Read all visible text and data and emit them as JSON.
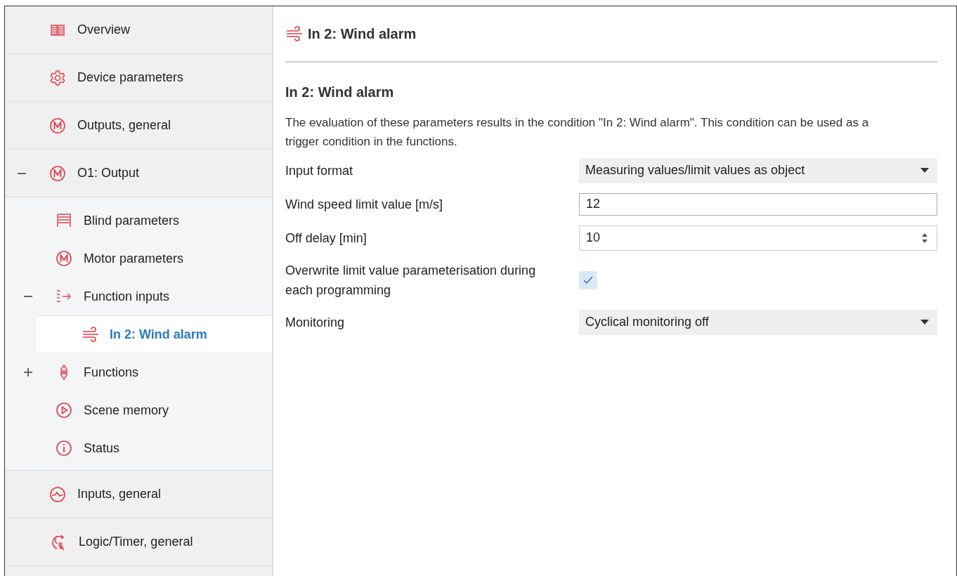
{
  "sidebar": {
    "items": [
      {
        "label": "Overview",
        "selected": false
      },
      {
        "label": "Device parameters",
        "selected": false
      },
      {
        "label": "Outputs, general",
        "selected": false
      },
      {
        "label": "O1: Output",
        "selected": false,
        "expanded": true,
        "children": [
          {
            "label": "Blind parameters",
            "selected": false
          },
          {
            "label": "Motor parameters",
            "selected": false
          },
          {
            "label": "Function inputs",
            "selected": false,
            "expanded": true,
            "children": [
              {
                "label": "In 2: Wind alarm",
                "selected": true
              }
            ]
          },
          {
            "label": "Functions",
            "selected": false,
            "expanded": false
          },
          {
            "label": "Scene memory",
            "selected": false
          },
          {
            "label": "Status",
            "selected": false
          }
        ]
      },
      {
        "label": "Inputs, general",
        "selected": false
      },
      {
        "label": "Logic/Timer, general",
        "selected": false
      }
    ]
  },
  "page": {
    "title": "In 2: Wind alarm",
    "heading": "In 2: Wind alarm",
    "description": "The evaluation of these parameters results in the condition \"In 2: Wind alarm\". This condition can be used as a trigger condition in the functions.",
    "fields": [
      {
        "kind": "dropdown",
        "label": "Input format",
        "value": "Measuring values/limit values as object"
      },
      {
        "kind": "text",
        "label": "Wind speed limit value [m/s]",
        "value": "12"
      },
      {
        "kind": "spinner",
        "label": "Off delay [min]",
        "value": "10"
      },
      {
        "kind": "checkbox",
        "label": "Overwrite limit value parameterisation during each programming",
        "checked": true
      },
      {
        "kind": "dropdown",
        "label": "Monitoring",
        "value": "Cyclical monitoring off"
      }
    ]
  }
}
